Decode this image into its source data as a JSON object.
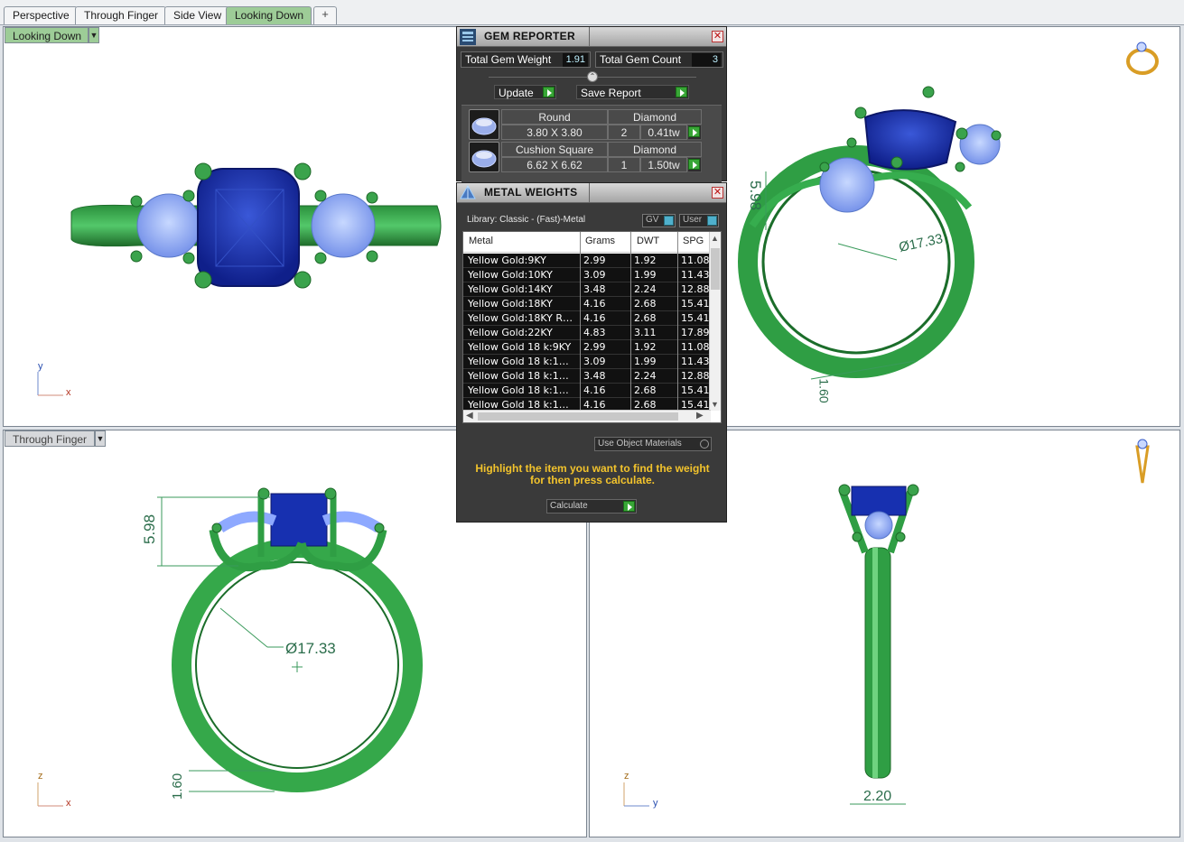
{
  "tabs": [
    {
      "label": "Perspective"
    },
    {
      "label": "Through Finger"
    },
    {
      "label": "Side View"
    },
    {
      "label": "Looking Down"
    }
  ],
  "tab_add": "+",
  "viewports": {
    "top_left": {
      "label": "Looking Down",
      "axis_y": "y",
      "axis_x": "x"
    },
    "top_right": {
      "dim_height": "5.98",
      "dim_diameter": "Ø17.33",
      "dim_bottom": "1.60"
    },
    "bottom_left": {
      "label": "Through Finger",
      "dim_height": "5.98",
      "dim_diameter": "Ø17.33",
      "dim_thickness": "1.60",
      "axis_z": "z",
      "axis_x": "x"
    },
    "bottom_right": {
      "dim_width": "2.20",
      "axis_z": "z",
      "axis_y": "y"
    }
  },
  "gem_reporter": {
    "title": "GEM REPORTER",
    "total_weight_label": "Total Gem Weight",
    "total_weight_value": "1.91",
    "total_count_label": "Total Gem Count",
    "total_count_value": "3",
    "update_label": "Update",
    "save_label": "Save Report",
    "gems": [
      {
        "shape": "Round",
        "type": "Diamond",
        "size": "3.80 X 3.80",
        "count": "2",
        "weight": "0.41tw"
      },
      {
        "shape": "Cushion Square",
        "type": "Diamond",
        "size": "6.62 X 6.62",
        "count": "1",
        "weight": "1.50tw"
      }
    ]
  },
  "metal_weights": {
    "title": "METAL WEIGHTS",
    "library": "Library: Classic - (Fast)-Metal",
    "toggle_gv": "GV",
    "toggle_user": "User",
    "columns": [
      "Metal",
      "Grams",
      "DWT",
      "SPG"
    ],
    "rows": [
      [
        "Yellow Gold:9KY",
        "2.99",
        "1.92",
        "11.08"
      ],
      [
        "Yellow Gold:10KY",
        "3.09",
        "1.99",
        "11.43"
      ],
      [
        "Yellow Gold:14KY",
        "3.48",
        "2.24",
        "12.88"
      ],
      [
        "Yellow Gold:18KY",
        "4.16",
        "2.68",
        "15.41"
      ],
      [
        "Yellow Gold:18KY R…",
        "4.16",
        "2.68",
        "15.41"
      ],
      [
        "Yellow Gold:22KY",
        "4.83",
        "3.11",
        "17.89"
      ],
      [
        "Yellow Gold 18 k:9KY",
        "2.99",
        "1.92",
        "11.08"
      ],
      [
        "Yellow Gold 18 k:1…",
        "3.09",
        "1.99",
        "11.43"
      ],
      [
        "Yellow Gold 18 k:1…",
        "3.48",
        "2.24",
        "12.88"
      ],
      [
        "Yellow Gold 18 k:1…",
        "4.16",
        "2.68",
        "15.41"
      ],
      [
        "Yellow Gold 18 k:1…",
        "4.16",
        "2.68",
        "15.41"
      ]
    ],
    "use_object_materials": "Use Object Materials",
    "hint": "Highlight the item you want to find the weight for then press calculate.",
    "calculate_label": "Calculate"
  }
}
